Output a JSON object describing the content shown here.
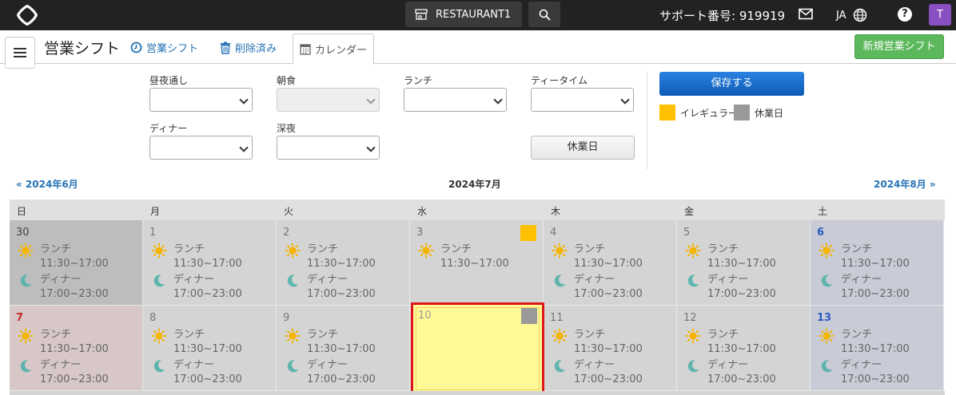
{
  "topbar": {
    "restaurant_name": "RESTAURANT1",
    "support_text": "サポート番号: 919919",
    "language": "JA",
    "help_label": "?",
    "avatar_letter": "T"
  },
  "subheader": {
    "page_title": "営業シフト",
    "tabs": [
      {
        "label": "営業シフト",
        "icon": "clock-icon"
      },
      {
        "label": "削除済み",
        "icon": "trash-icon"
      },
      {
        "label": "カレンダー",
        "icon": "calendar-icon"
      }
    ],
    "new_button_label": "新規営業シフト"
  },
  "form": {
    "fields": [
      {
        "label": "昼夜通し",
        "value": "",
        "disabled": false
      },
      {
        "label": "朝食",
        "value": "",
        "disabled": true
      },
      {
        "label": "ランチ",
        "value": "",
        "disabled": false
      },
      {
        "label": "ティータイム",
        "value": "",
        "disabled": false
      },
      {
        "label": "ディナー",
        "value": "",
        "disabled": false
      },
      {
        "label": "深夜",
        "value": "",
        "disabled": false
      }
    ],
    "holiday_button": "休業日",
    "save_button": "保存する",
    "legend": [
      {
        "label": "イレギュラー",
        "color": "#ffc000"
      },
      {
        "label": "休業日",
        "color": "#999999"
      }
    ]
  },
  "calendar": {
    "prev_month": "« 2024年6月",
    "current_month": "2024年7月",
    "next_month": "2024年8月 »",
    "weekdays": [
      "日",
      "月",
      "火",
      "水",
      "木",
      "金",
      "土"
    ],
    "lunch_label": "ランチ",
    "lunch_time": "11:30~17:00",
    "dinner_label": "ディナー",
    "dinner_time": "17:00~23:00",
    "week1": [
      "30",
      "1",
      "2",
      "3",
      "4",
      "5",
      "6"
    ],
    "week2": [
      "7",
      "8",
      "9",
      "10",
      "11",
      "12",
      "13"
    ]
  }
}
